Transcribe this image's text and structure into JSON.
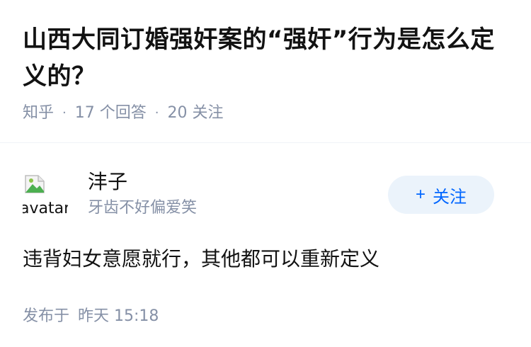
{
  "question": {
    "title": "山西大同订婚强奸案的“强奸”行为是怎么定义的？",
    "source": "知乎",
    "separator": "·",
    "answers_count": "17",
    "answers_label": "个回答",
    "follows_count": "20",
    "follows_label": "关注"
  },
  "answer": {
    "author": {
      "name": "沣子",
      "bio": "牙齿不好偏爱笑",
      "avatar_alt": "avatar"
    },
    "follow_button": {
      "icon": "+",
      "label": "关注"
    },
    "content": "违背妇女意愿就行，其他都可以重新定义",
    "published_label": "发布于",
    "published_time": "昨天 15:18"
  },
  "colors": {
    "text": "#121212",
    "meta": "#8590a6",
    "accent": "#0066ff",
    "button_bg": "#ebf3fb"
  }
}
